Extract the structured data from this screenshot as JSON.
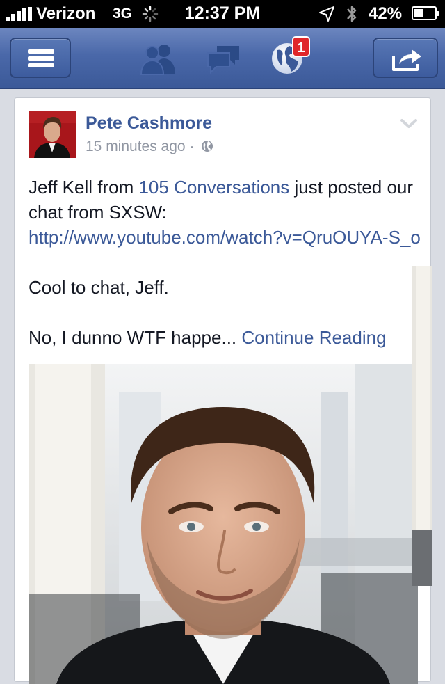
{
  "status_bar": {
    "carrier": "Verizon",
    "network": "3G",
    "time": "12:37 PM",
    "battery_percent": "42%",
    "battery_level": 0.42,
    "icons": [
      "signal-icon",
      "loading-spinner-icon",
      "location-arrow-icon",
      "bluetooth-icon",
      "battery-icon"
    ]
  },
  "nav_bar": {
    "icons": [
      "menu-icon",
      "friend-requests-icon",
      "messages-icon",
      "notifications-globe-icon",
      "share-icon"
    ],
    "notifications_badge": "1",
    "colors": {
      "bar": "#4a68a9",
      "badge": "#e0262a"
    }
  },
  "post": {
    "author": "Pete Cashmore",
    "timestamp": "15 minutes ago",
    "separator": "·",
    "privacy_icon": "public-globe-icon",
    "text_intro": "Jeff Kell from ",
    "link_page": "105 Conversations",
    "text_mid": " just posted our chat from SXSW: ",
    "link_url": "http://www.youtube.com/watch?v=QruOUYA-S_o",
    "paragraph_2": "Cool to chat, Jeff.",
    "paragraph_3": "No, I dunno WTF happe...",
    "continue_label": "Continue Reading",
    "colors": {
      "link": "#3b5998",
      "text": "#141823",
      "meta": "#9197a3"
    }
  }
}
